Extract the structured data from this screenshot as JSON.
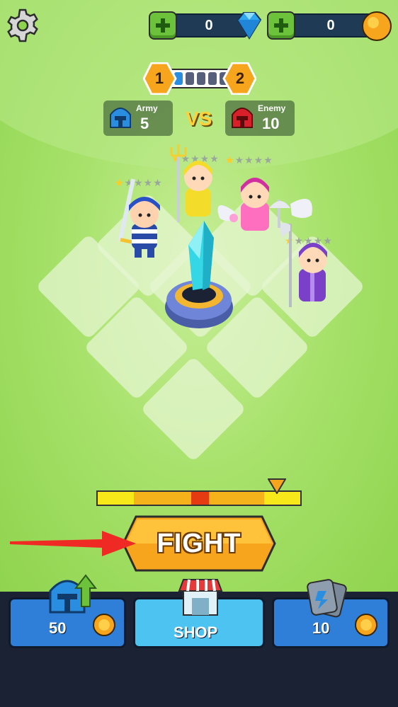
{
  "resources": {
    "gems": "0",
    "coins": "0"
  },
  "level": {
    "current": "1",
    "next": "2"
  },
  "army": {
    "label": "Army",
    "count": "5"
  },
  "enemy": {
    "label": "Enemy",
    "count": "10"
  },
  "vs_label": "VS",
  "fight_label": "FIGHT",
  "bottom": {
    "upgrade_cost": "50",
    "shop_label": "SHOP",
    "cards_cost": "10"
  },
  "units": [
    {
      "name": "blue-swordsman",
      "stars": 1
    },
    {
      "name": "yellow-trident",
      "stars": 1
    },
    {
      "name": "pink-winged",
      "stars": 1
    },
    {
      "name": "purple-scythe",
      "stars": 1
    }
  ],
  "colors": {
    "army": "#2a8ee0",
    "enemy": "#d8202a",
    "fight": "#f7a51c",
    "shop": "#4cc3f0"
  },
  "icons": [
    "gear-icon",
    "plus-icon",
    "gem-icon",
    "coin-icon",
    "helmet-icon",
    "arrow-up-icon",
    "shop-icon",
    "cards-icon",
    "hand-pointer-icon"
  ]
}
